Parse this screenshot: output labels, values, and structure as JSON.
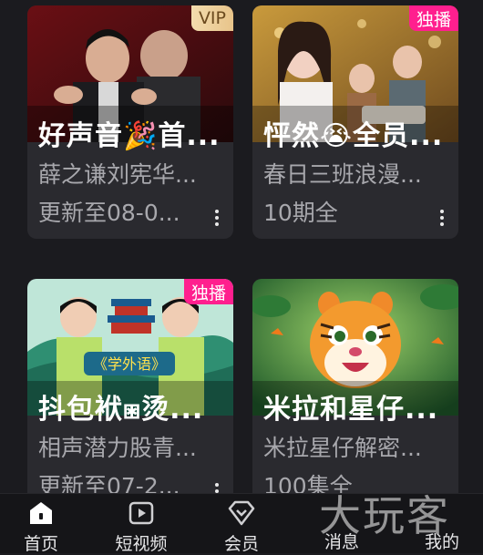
{
  "cards": [
    {
      "badge": "VIP",
      "title": "好声音🎉首...",
      "subtitle": "薛之谦刘宪华...",
      "update": "更新至08-0..."
    },
    {
      "badge": "独播",
      "title": "怦然😭全员...",
      "subtitle": "春日三班浪漫...",
      "update": "10期全"
    },
    {
      "badge": "独播",
      "title": "抖包袱⧆烫...",
      "subtitle": "相声潜力股青...",
      "update": "更新至07-2...",
      "thumb_text": "《学外语》"
    },
    {
      "badge": "",
      "title": "米拉和星仔...",
      "subtitle": "米拉星仔解密...",
      "update": "100集全"
    }
  ],
  "tabs": [
    {
      "label": "首页",
      "icon": "home-icon"
    },
    {
      "label": "短视频",
      "icon": "play-icon"
    },
    {
      "label": "会员",
      "icon": "diamond-icon"
    },
    {
      "label": "消息",
      "icon": "message-icon"
    },
    {
      "label": "我的",
      "icon": "profile-icon"
    }
  ],
  "watermark": "大玩客",
  "colors": {
    "badge_exclusive": "#ff1f8e",
    "badge_vip": "#e8c48a",
    "card_bg": "#2a2a2f"
  }
}
